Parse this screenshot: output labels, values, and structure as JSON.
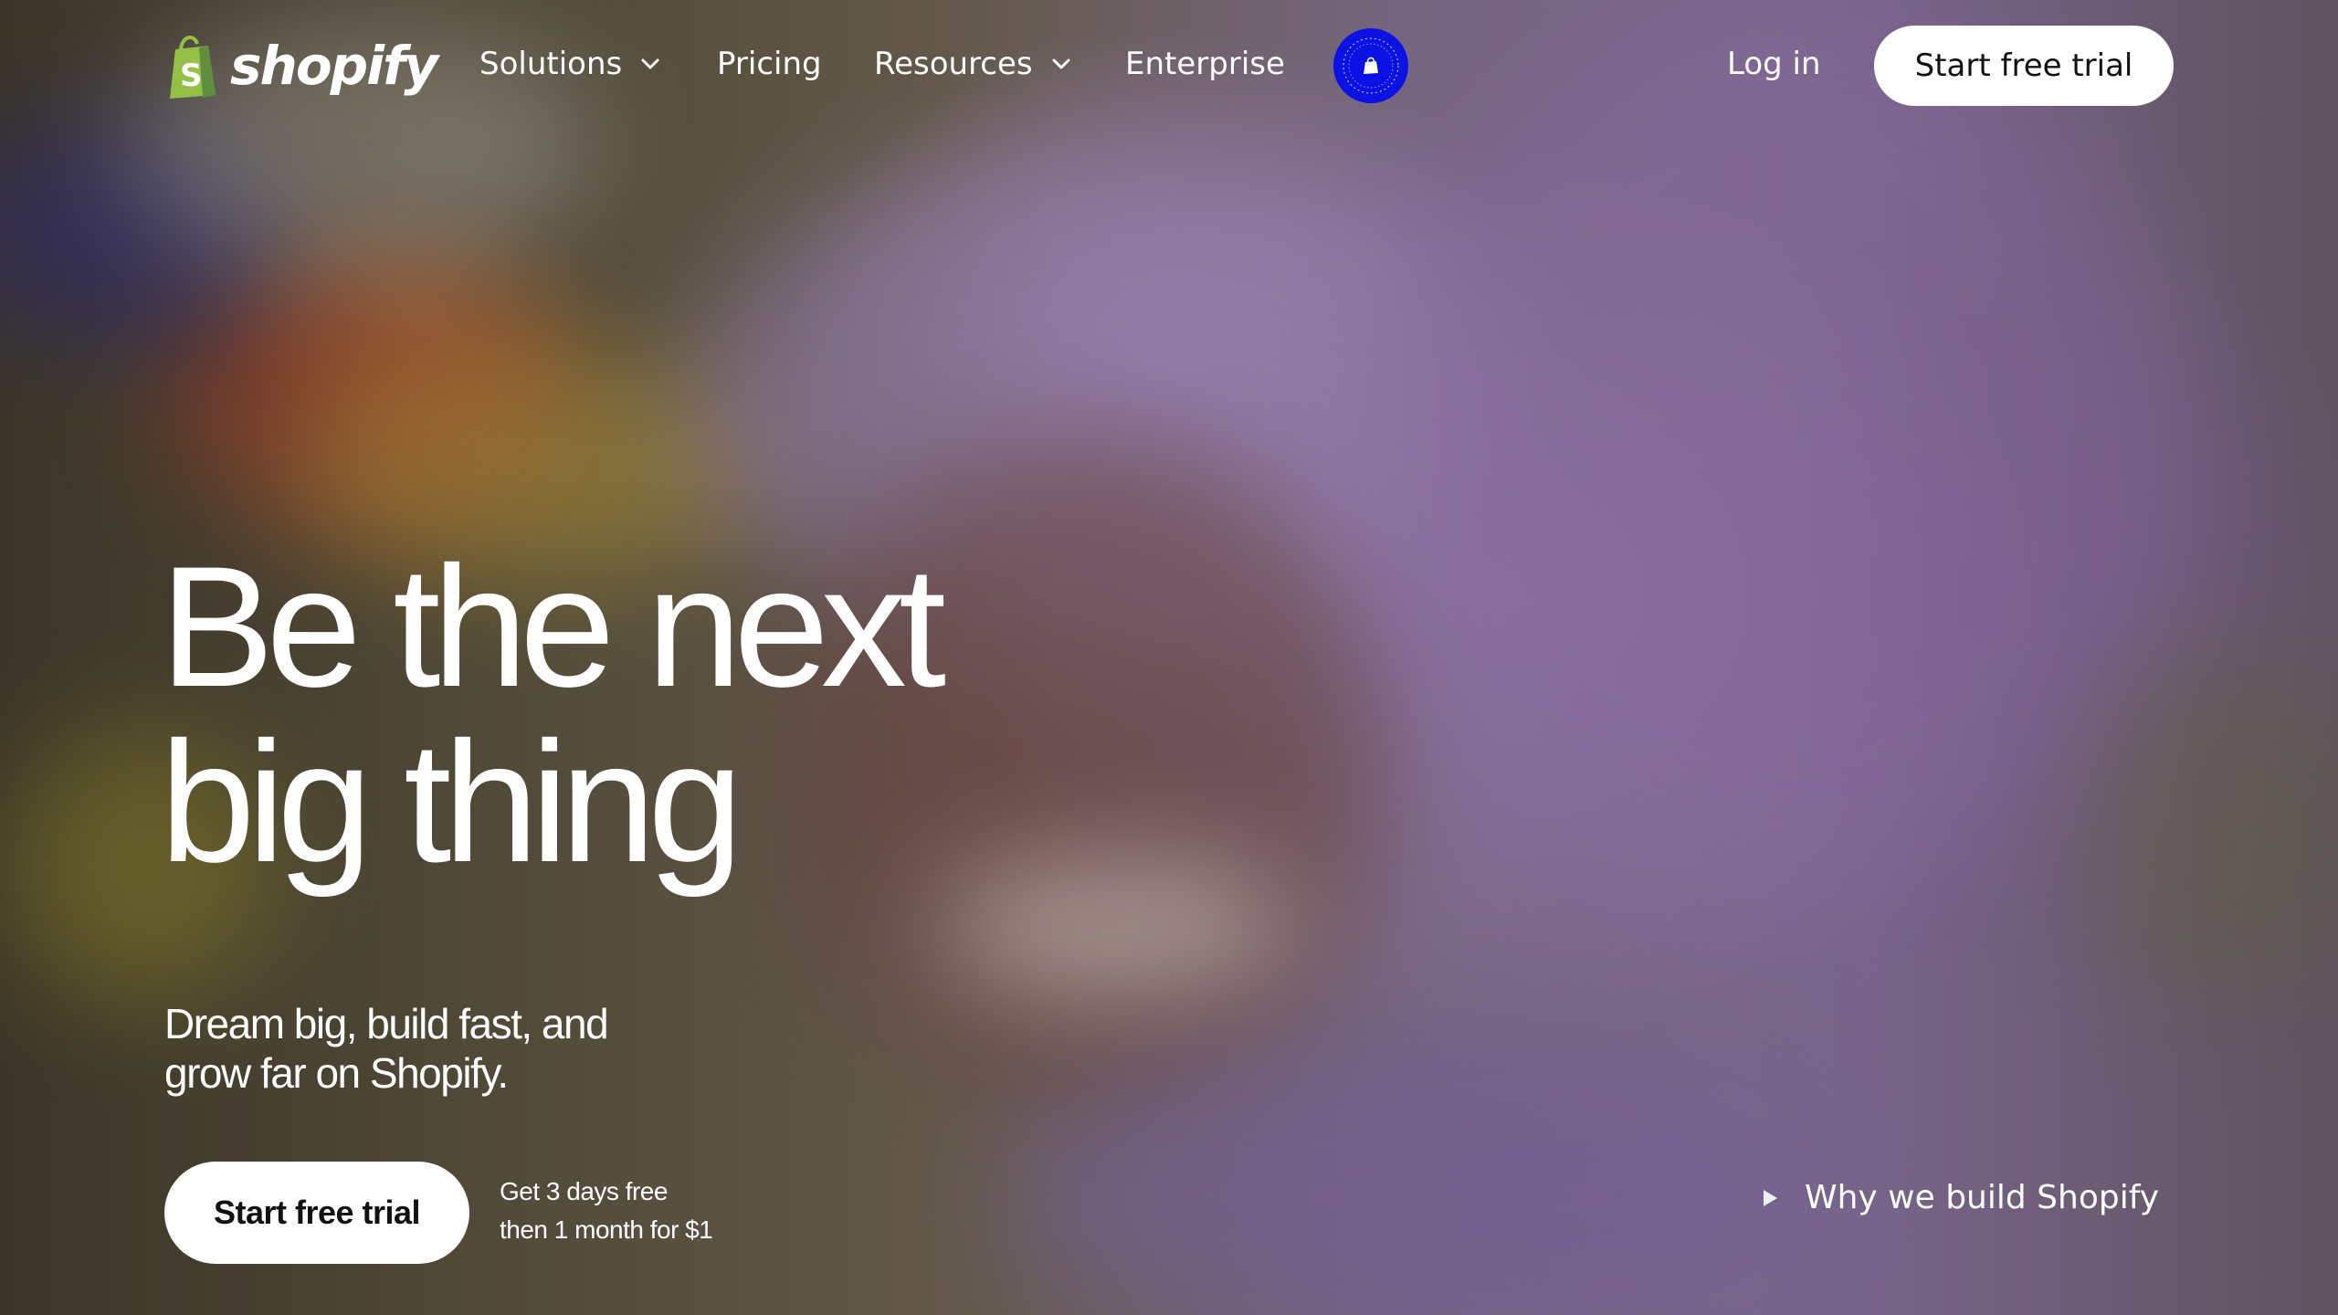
{
  "brand": {
    "name": "shopify",
    "logo_icon": "shopify-bag-icon",
    "logo_green": "#95bf47"
  },
  "nav": {
    "items": [
      {
        "label": "Solutions",
        "icon": "chevron-down-icon"
      },
      {
        "label": "Pricing"
      },
      {
        "label": "Resources",
        "icon": "chevron-down-icon"
      },
      {
        "label": "Enterprise"
      }
    ],
    "badge": {
      "icon": "shopify-editions-badge-icon",
      "color": "#0a12e6"
    },
    "login_label": "Log in",
    "cta_label": "Start free trial"
  },
  "hero": {
    "headline_line1": "Be the next",
    "headline_line2": "big thing",
    "subhead": "Dream big, build fast, and grow far on Shopify.",
    "cta_label": "Start free trial",
    "trial_note_line1": "Get 3 days free",
    "trial_note_line2": "then 1 month for $1",
    "video_link_icon": "play-icon",
    "video_link_label": "Why we build Shopify"
  }
}
